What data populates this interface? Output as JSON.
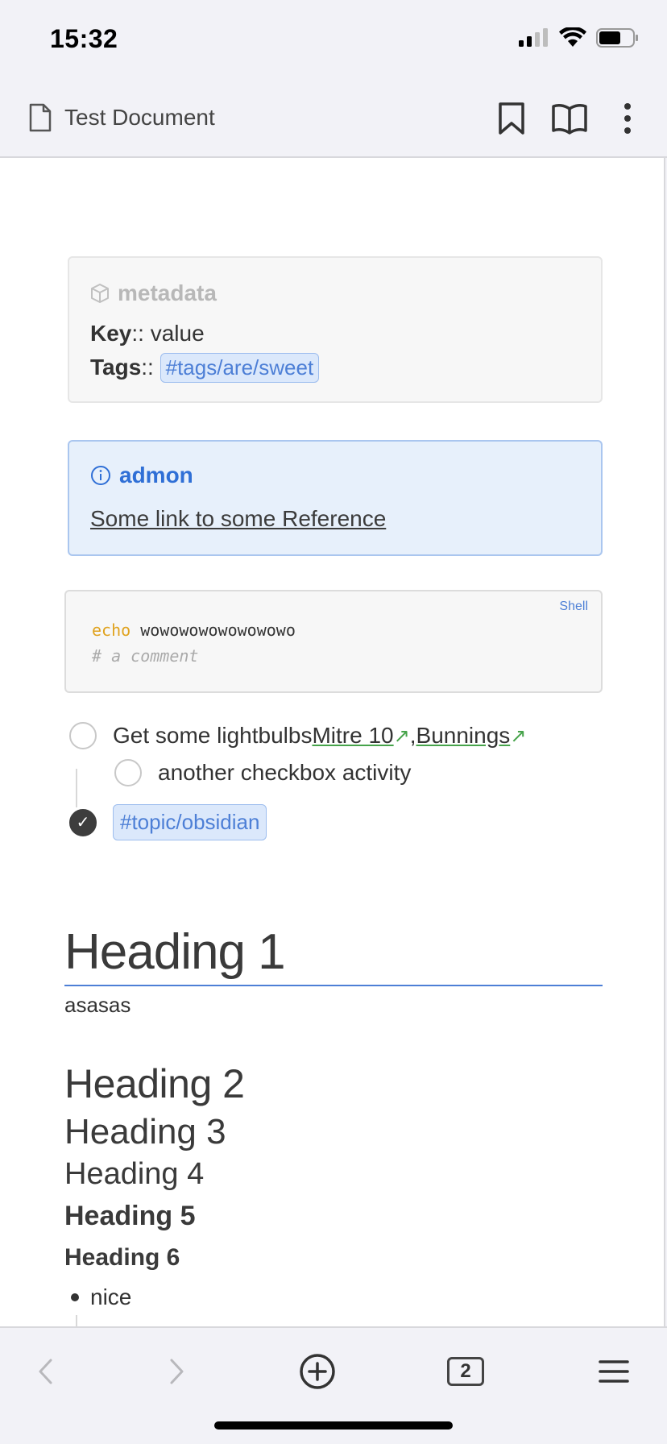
{
  "status_bar": {
    "time": "15:32"
  },
  "nav": {
    "title": "Test Document"
  },
  "metadata": {
    "title": "metadata",
    "rows": [
      {
        "key": "Key",
        "sep": ":: ",
        "value": "value"
      },
      {
        "key": "Tags",
        "sep": ":: ",
        "tag": "#tags/are/sweet"
      }
    ]
  },
  "admon": {
    "title": "admon",
    "link": "Some link to some Reference"
  },
  "code": {
    "lang": "Shell",
    "line1_cmd": "echo",
    "line1_arg": "wowowowowowowowo",
    "line2": "# a comment"
  },
  "tasks": {
    "task1_text": "Get some lightbulbs ",
    "link1": "Mitre 10",
    "comma": ", ",
    "link2": "Bunnings",
    "arrow": "↗",
    "task2_text": "another checkbox activity",
    "task3_tag": "#topic/obsidian",
    "checkmark": "✓"
  },
  "headings": {
    "h1": "Heading 1",
    "paragraph": "asasas",
    "h2": "Heading 2",
    "h3": "Heading 3",
    "h4": "Heading 4",
    "h5": "Heading 5",
    "h6": "Heading 6"
  },
  "list": {
    "item1": "nice"
  },
  "toolbar": {
    "tab_count": "2"
  },
  "icons": {
    "nav": [
      "document-icon",
      "bookmark-icon",
      "reader-icon",
      "more-vertical-icon"
    ],
    "toolbar": [
      "back-icon",
      "forward-icon",
      "new-tab-icon",
      "tabs-icon",
      "menu-icon"
    ]
  },
  "colors": {
    "accent": "#4d7fd6",
    "link_green": "#46a34a",
    "admon_blue": "#2f6fd6"
  }
}
